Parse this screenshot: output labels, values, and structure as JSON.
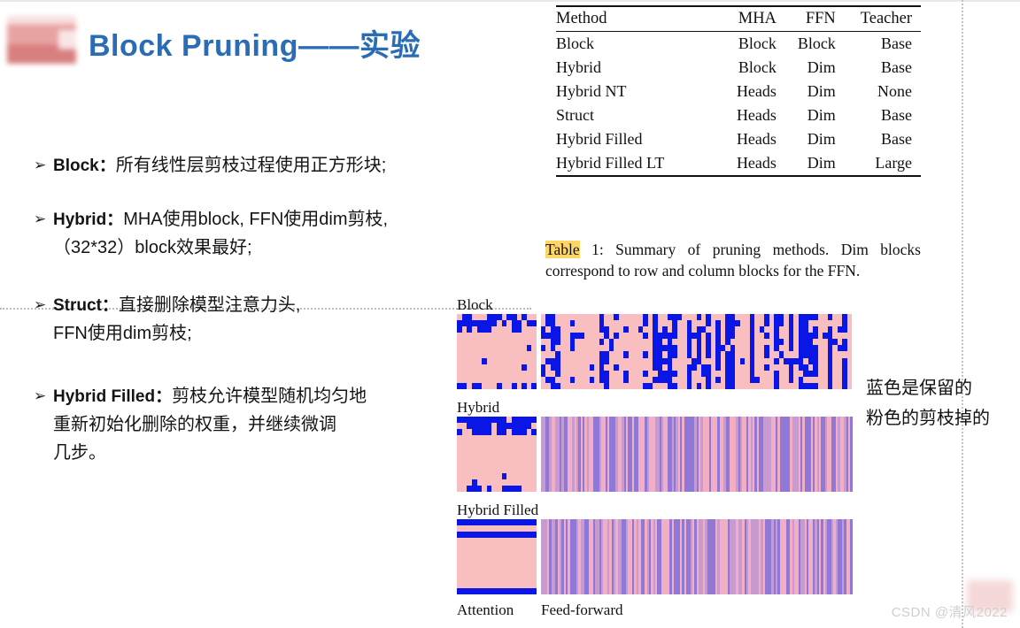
{
  "slide": {
    "title": "Block Pruning——实验",
    "title_color": "#2a6db5",
    "logo": "redacted-logo-block"
  },
  "bullets": [
    {
      "marker": "➢",
      "head": "Block：",
      "text": "所有线性层剪枝过程使用正方形块;",
      "sub": []
    },
    {
      "marker": "➢",
      "head": "Hybrid：",
      "text": "MHA使用block, FFN使用dim剪枝,",
      "sub": [
        "（32*32）block效果最好;"
      ]
    },
    {
      "marker": "➢",
      "head": "Struct：",
      "text": "直接删除模型注意力头,",
      "sub": [
        "FFN使用dim剪枝;"
      ]
    },
    {
      "marker": "➢",
      "head": "Hybrid Filled：",
      "text": "剪枝允许模型随机均匀地",
      "sub": [
        "重新初始化删除的权重，并继续微调",
        "几步。"
      ]
    }
  ],
  "table": {
    "headers": [
      "Method",
      "MHA",
      "FFN",
      "Teacher"
    ],
    "rows": [
      [
        "Block",
        "Block",
        "Block",
        "Base"
      ],
      [
        "Hybrid",
        "Block",
        "Dim",
        "Base"
      ],
      [
        "Hybrid NT",
        "Heads",
        "Dim",
        "None"
      ],
      [
        "Struct",
        "Heads",
        "Dim",
        "Base"
      ],
      [
        "Hybrid Filled",
        "Heads",
        "Dim",
        "Base"
      ],
      [
        "Hybrid Filled LT",
        "Heads",
        "Dim",
        "Large"
      ]
    ],
    "caption_highlight": "Table",
    "caption_rest": " 1: Summary of pruning methods. Dim blocks correspond to row and column blocks for the FFN."
  },
  "figure": {
    "colors": {
      "kept_blue": "#0a16e6",
      "pruned_pink": "#f9bfc0",
      "ffn_purple": "#8f78d6",
      "ffn_pink": "#f2aec2"
    },
    "panels": [
      {
        "label": "Block"
      },
      {
        "label": "Hybrid"
      },
      {
        "label": "Hybrid Filled"
      }
    ],
    "axis": {
      "attention": "Attention",
      "feedforward": "Feed-forward"
    }
  },
  "note": {
    "line1": "蓝色是保留的",
    "line2": "粉色的剪枝掉的"
  },
  "watermark": {
    "text": "CSDN @清风2022"
  }
}
